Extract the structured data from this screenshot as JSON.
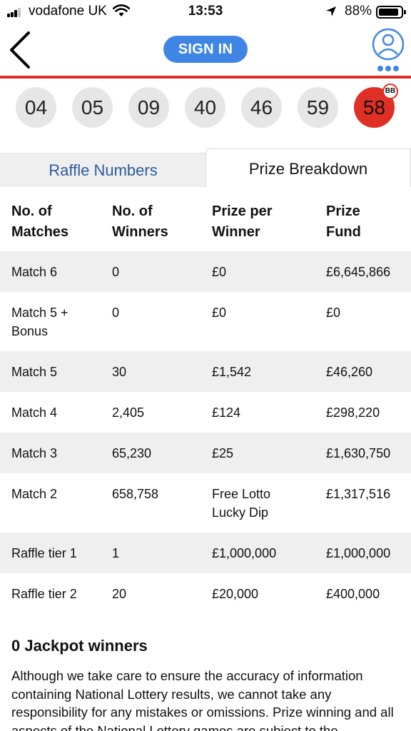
{
  "status_bar": {
    "carrier": "vodafone UK",
    "time": "13:53",
    "battery_percent": "88%",
    "battery_level": 0.88,
    "icons": [
      "signal-icon",
      "wifi-icon",
      "location-arrow-icon",
      "battery-icon"
    ]
  },
  "header": {
    "back_icon": "chevron-left-icon",
    "sign_in_label": "SIGN IN",
    "account_icon": "user-account-icon",
    "accent_color": "#3f86e4",
    "brand_red": "#e02f24"
  },
  "balls": {
    "main": [
      "04",
      "05",
      "09",
      "40",
      "46",
      "59"
    ],
    "bonus": "58",
    "bonus_badge": "BB"
  },
  "tabs": {
    "raffle_label": "Raffle Numbers",
    "prize_label": "Prize Breakdown",
    "active": "Prize Breakdown"
  },
  "table": {
    "headers": [
      "No. of\nMatches",
      "No. of\nWinners",
      "Prize per\nWinner",
      "Prize\nFund"
    ],
    "rows": [
      [
        "Match 6",
        "0",
        "£0",
        "£6,645,866"
      ],
      [
        "Match 5 +\nBonus",
        "0",
        "£0",
        "£0"
      ],
      [
        "Match 5",
        "30",
        "£1,542",
        "£46,260"
      ],
      [
        "Match 4",
        "2,405",
        "£124",
        "£298,220"
      ],
      [
        "Match 3",
        "65,230",
        "£25",
        "£1,630,750"
      ],
      [
        "Match 2",
        "658,758",
        "Free Lotto\nLucky Dip",
        "£1,317,516"
      ],
      [
        "Raffle tier 1",
        "1",
        "£1,000,000",
        "£1,000,000"
      ],
      [
        "Raffle tier 2",
        "20",
        "£20,000",
        "£400,000"
      ]
    ]
  },
  "jackpot_text": "0 Jackpot winners",
  "disclaimer": "Although we take care to ensure the accuracy of information containing National Lottery results, we cannot take any responsibility for any mistakes or omissions. Prize winning and all aspects of the National Lottery games are subject to the"
}
